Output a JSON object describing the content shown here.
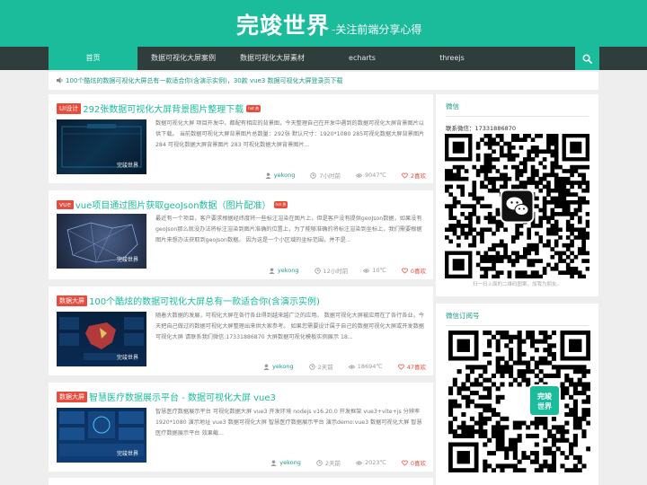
{
  "header": {
    "logo_main": "完竣世界",
    "logo_sub": "-关注前端分享心得"
  },
  "nav": {
    "items": [
      {
        "label": "首页",
        "active": true
      },
      {
        "label": "数据可视化大屏案例",
        "active": false
      },
      {
        "label": "数据可视化大屏素材",
        "active": false
      },
      {
        "label": "echarts",
        "active": false
      },
      {
        "label": "threejs",
        "active": false
      }
    ],
    "search_icon": "search-icon"
  },
  "notice": {
    "icon": "speaker-icon",
    "text": "100个酷炫的数据可视化大屏总有一款适合你(含演示实例)，30款 vue3 数据可视化大屏登录页下载"
  },
  "posts": [
    {
      "tag": "UI设计",
      "title": "292张数据可视化大屏背景图片整理下载",
      "hot": "hot 热",
      "thumb_caption": "完竣世界",
      "excerpt": "数据可视化大屏 项目开发中，都配有相应的背景图，今天整理自己在开发中遇到的数据可视化大屏背景图片以供下载。  当前数据可视化大屏背景图片总数量：292张 默认尺寸：1920*1080 285可视化数据大屏背景图片 284 可视化数据大屏背景图片 283 可视化数据大屏背景图片...",
      "author": "yekong",
      "time": "7小时前",
      "views": "9047℃",
      "likes": "2喜欢"
    },
    {
      "tag": "vue",
      "title": "vue项目通过图片获取geoJson数据（图片配准）",
      "hot": "hot 热",
      "thumb_caption": "完竣世界",
      "excerpt": "最近有一个项目，客户要求根据经纬度将一些标注渲染在图片上，但是客户没有提供geoJson数据，如果没有geoJson那么就没办法将标注渲染到图片准确的位置上，为了能够准确的将标注渲染到坐标上，我们需要根据图片来想办法获取到geoJson数据。 因为这是一个小区域的坐标范围，并不是...",
      "author": "yekong",
      "time": "12小时前",
      "views": "10℃",
      "likes": "0喜欢"
    },
    {
      "tag": "数据大屏",
      "title": "100个酷炫的数据可视化大屏总有一款适合你(含演示实例)",
      "thumb_caption": "完竣世界",
      "excerpt": "随着大数据的发展，可视化大屏在各行各业得到越来越广泛的应用。 数据可视化大屏被应用在了各行各业，今天把自己做过的数据可视化大屏整理出来供大家参考。 如果您需要设计属于自己的数据可视化大屏或开发数据可视化大屏 请联系我们微信:17331886870 大屏数据可视化模板实例展示 18...",
      "author": "yekong",
      "time": "2天前",
      "views": "18694℃",
      "likes": "47喜欢"
    },
    {
      "tag": "数据大屏",
      "title": "智慧医疗数据展示平台 - 数据可视化大屏 vue3",
      "thumb_caption": "完竣世界",
      "excerpt": "智慧医疗数据展示平台 可视化数据大屏 vue3 开发环境 nodejs v16.20.0 开发框架 vue3+vite+js 分辨率 1920*1080 演示地址 vue3 数据可视化大屏 智慧医疗数据展示平台 演示demo:vue3 数据可视化大屏 智慧医疗数据展示平台 效果截...",
      "author": "yekong",
      "time": "2天前",
      "views": "2023℃",
      "likes": "0喜欢"
    }
  ],
  "sidebar": {
    "wechat": {
      "title": "微信",
      "contact": "联系微信：17331886870",
      "note": "扫一扫上面的二维码图案，加我为朋友。"
    },
    "subscription": {
      "title": "微信订阅号",
      "badge": "完竣世界"
    }
  },
  "colors": {
    "accent": "#1abc9c",
    "nav_bg": "#2f3d3b",
    "tag": "#e74c3c"
  }
}
